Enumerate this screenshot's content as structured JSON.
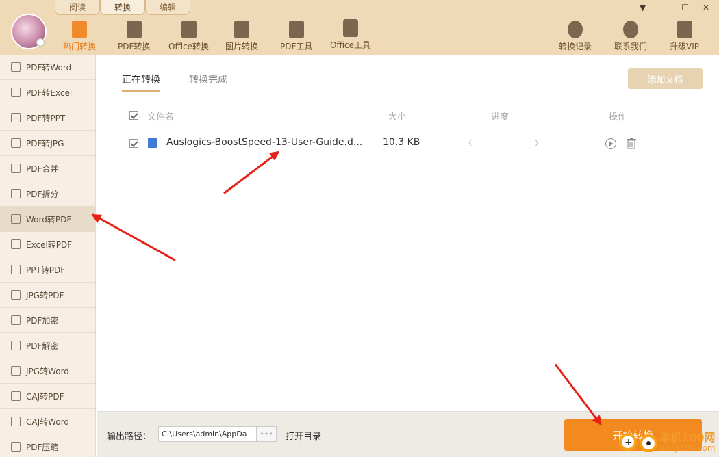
{
  "window": {
    "tabs": [
      "阅读",
      "转换",
      "编辑"
    ],
    "active_tab": 1,
    "controls": [
      "▼",
      "—",
      "☐",
      "✕"
    ]
  },
  "toolbar": {
    "items": [
      {
        "label": "热门转换",
        "icon": "hot-convert-icon",
        "active": true
      },
      {
        "label": "PDF转换",
        "icon": "pdf-convert-icon",
        "active": false
      },
      {
        "label": "Office转换",
        "icon": "office-convert-icon",
        "active": false
      },
      {
        "label": "图片转换",
        "icon": "image-convert-icon",
        "active": false
      },
      {
        "label": "PDF工具",
        "icon": "pdf-tools-icon",
        "active": false
      },
      {
        "label": "Office工具",
        "icon": "office-tools-icon",
        "active": false
      }
    ],
    "right_items": [
      {
        "label": "转换记录",
        "icon": "history-icon"
      },
      {
        "label": "联系我们",
        "icon": "support-icon"
      },
      {
        "label": "升级VIP",
        "icon": "crown-icon"
      }
    ]
  },
  "sidebar": {
    "items": [
      "PDF转Word",
      "PDF转Excel",
      "PDF转PPT",
      "PDF转JPG",
      "PDF合并",
      "PDF拆分",
      "Word转PDF",
      "Excel转PDF",
      "PPT转PDF",
      "JPG转PDF",
      "PDF加密",
      "PDF解密",
      "JPG转Word",
      "CAJ转PDF",
      "CAJ转Word",
      "PDF压缩"
    ],
    "active_index": 6
  },
  "main": {
    "subtabs": [
      "正在转换",
      "转换完成"
    ],
    "active_subtab": 0,
    "add_button": "添加文档",
    "columns": {
      "name": "文件名",
      "size": "大小",
      "progress": "进度",
      "action": "操作"
    },
    "files": [
      {
        "name": "Auslogics-BoostSpeed-13-User-Guide.d...",
        "size": "10.3 KB",
        "progress": 0.0,
        "checked": true
      }
    ]
  },
  "bottom": {
    "output_label": "输出路径：",
    "output_path": "C:\\Users\\admin\\AppDa",
    "browse_label": "•••",
    "open_dir_label": "打开目录",
    "start_button": "开始转换"
  },
  "watermark": {
    "text1": "单机100网",
    "text2": "danji100.com"
  },
  "colors": {
    "accent": "#f28a1f",
    "header_bg": "#efd9b6",
    "sidebar_bg": "#f7efe4",
    "annotation_arrow": "#e62117"
  }
}
